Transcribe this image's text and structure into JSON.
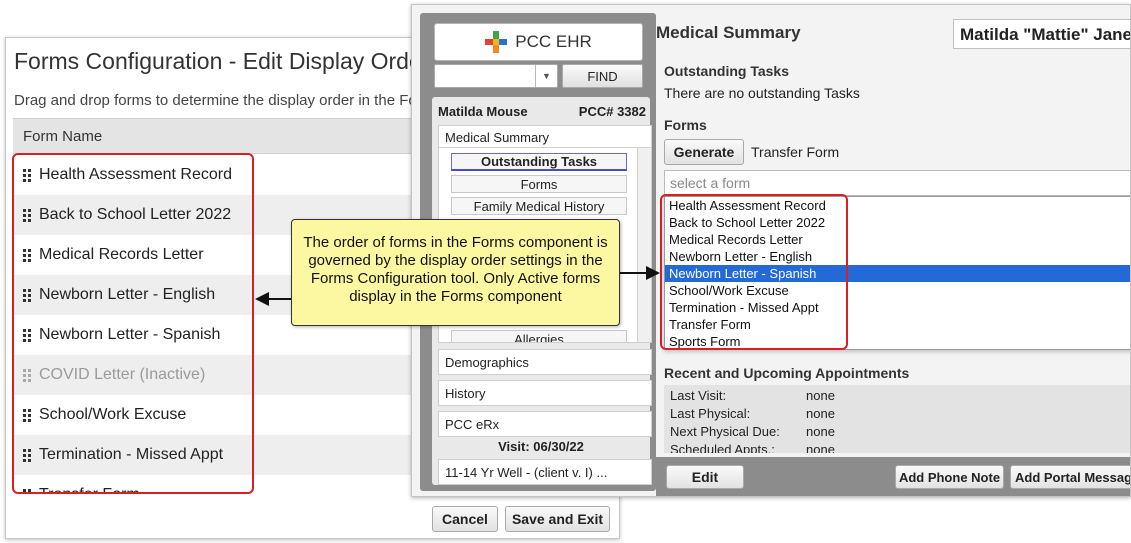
{
  "forms_config": {
    "title": "Forms Configuration - Edit Display Order",
    "description": "Drag and drop forms to determine the display order in the Forms component.",
    "column_header": "Form Name",
    "rows": [
      {
        "name": "Health Assessment Record",
        "active": true
      },
      {
        "name": "Back to School Letter 2022",
        "active": true
      },
      {
        "name": "Medical Records Letter",
        "active": true
      },
      {
        "name": "Newborn Letter - English",
        "active": true
      },
      {
        "name": "Newborn Letter - Spanish",
        "active": true
      },
      {
        "name": "COVID Letter (Inactive)",
        "active": false
      },
      {
        "name": "School/Work Excuse",
        "active": true
      },
      {
        "name": "Termination - Missed Appt",
        "active": true
      },
      {
        "name": "Transfer Form",
        "active": true
      }
    ],
    "cancel_label": "Cancel",
    "save_label": "Save and Exit"
  },
  "ehr": {
    "app_name": "PCC EHR",
    "find_label": "FIND",
    "patient_name": "Matilda Mouse",
    "patient_number": "PCC# 3382",
    "nav_medical_summary": "Medical Summary",
    "sub_items": [
      "Outstanding Tasks",
      "Forms",
      "Family Medical History",
      "Allergies"
    ],
    "nav_demographics": "Demographics",
    "nav_history": "History",
    "nav_erx": "PCC eRx",
    "visit_label": "Visit: 06/30/22",
    "visit_item": "11-14 Yr Well - (client v. I) ...",
    "main_title": "Medical Summary",
    "patient_full_name": "Matilda \"Mattie\" Jane",
    "tasks_heading": "Outstanding Tasks",
    "tasks_text": "There are no outstanding Tasks",
    "forms_heading": "Forms",
    "generate_label": "Generate",
    "selected_form": "Transfer Form",
    "select_placeholder": "select a form",
    "dropdown_options": [
      "Health Assessment Record",
      "Back to School Letter 2022",
      "Medical Records Letter",
      "Newborn Letter - English",
      "Newborn Letter - Spanish",
      "School/Work Excuse",
      "Termination - Missed Appt",
      "Transfer Form",
      "Sports Form"
    ],
    "dropdown_selected": "Newborn Letter - Spanish",
    "appointments_heading": "Recent and Upcoming Appointments",
    "appointments": [
      {
        "label": "Last Visit:",
        "value": "none"
      },
      {
        "label": "Last Physical:",
        "value": "none"
      },
      {
        "label": "Next Physical Due:",
        "value": "none"
      },
      {
        "label": "Scheduled Appts.:",
        "value": "none"
      }
    ],
    "edit_label": "Edit",
    "phone_note_label": "Add Phone Note",
    "portal_message_label": "Add Portal Message"
  },
  "callout_text": "The order of forms in the Forms component is governed by the display order settings in the Forms Configuration tool. Only Active forms display in the Forms component",
  "colors": {
    "highlight_red": "#d71f26",
    "selected_blue": "#2469d8",
    "callout_yellow": "#fcf8a2"
  }
}
